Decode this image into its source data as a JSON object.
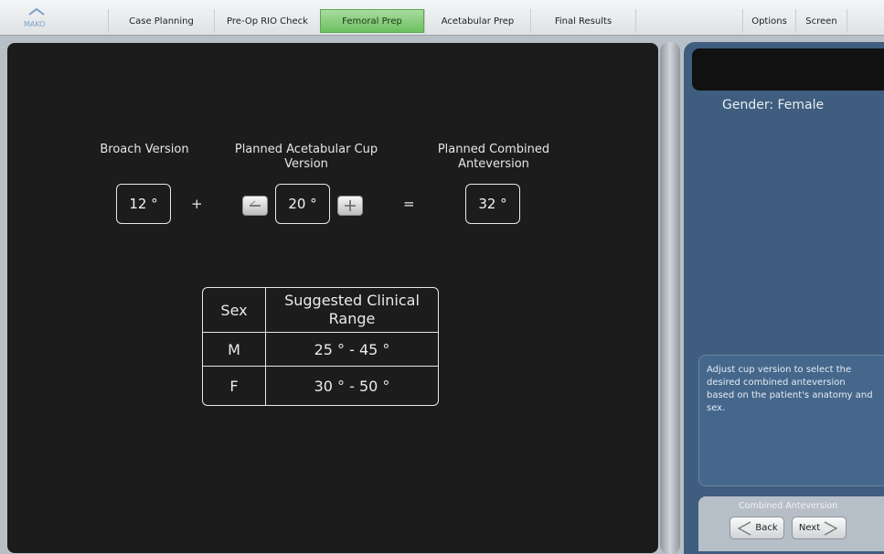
{
  "app": {
    "logo_text": "MAKO"
  },
  "tabs": [
    {
      "label": "Case Planning"
    },
    {
      "label": "Pre-Op RIO Check"
    },
    {
      "label": "Femoral Prep",
      "active": true
    },
    {
      "label": "Acetabular Prep"
    },
    {
      "label": "Final Results"
    }
  ],
  "top_right": {
    "options_label": "Options",
    "screen_label": "Screen"
  },
  "calc": {
    "broach_label": "Broach Version",
    "broach_value": "12 °",
    "plus": "+",
    "cup_label": "Planned Acetabular Cup Version",
    "cup_value": "20 °",
    "equals": "=",
    "combined_label": "Planned Combined Anteversion",
    "combined_value": "32 °",
    "decrement_icon": "minus-icon",
    "increment_icon": "plus-icon"
  },
  "range_table": {
    "headers": [
      "Sex",
      "Suggested Clinical Range"
    ],
    "rows": [
      [
        "M",
        "25 ° - 45 °"
      ],
      [
        "F",
        "30 ° - 50 °"
      ]
    ]
  },
  "right_panel": {
    "gender": "Gender: Female",
    "instructions": "Adjust cup version to select the desired combined anteversion based on the patient's anatomy and sex.",
    "step_title": "Combined Anteversion",
    "back_label": "Back",
    "next_label": "Next"
  },
  "colors": {
    "active_tab": "#7cc96e",
    "panel_dark": "#1c1c1c",
    "panel_blue": "#3f5d7e"
  }
}
